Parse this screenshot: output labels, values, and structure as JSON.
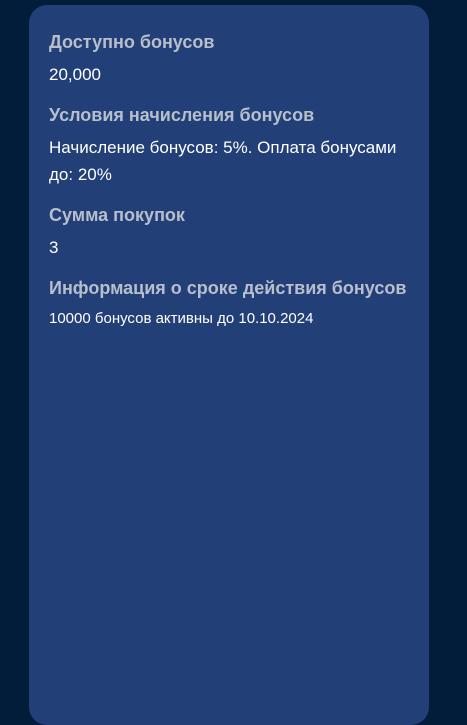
{
  "bonus": {
    "available": {
      "title": "Доступно бонусов",
      "value": "20,000"
    },
    "conditions": {
      "title": "Условия начисления бонусов",
      "value": "Начисление бонусов: 5%. Оплата бонусами до: 20%"
    },
    "purchases": {
      "title": "Сумма покупок",
      "value": "3"
    },
    "expiry": {
      "title": "Информация о сроке действия бонусов",
      "value": "10000 бонусов активны до 10.10.2024"
    }
  },
  "colors": {
    "page_background": "#021d3a",
    "card_background": "#223f77",
    "title_text": "#b8bfcc",
    "value_text": "#ffffff"
  }
}
